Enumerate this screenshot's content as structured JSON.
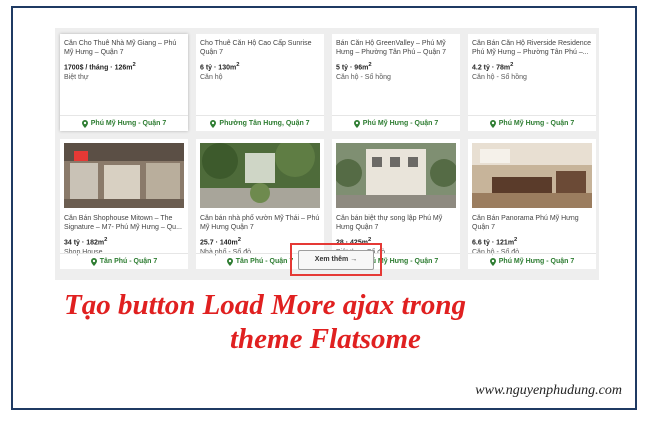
{
  "listings_row1": [
    {
      "title": "Căn Cho Thuê Nhà Mỹ Giang – Phú Mỹ Hưng – Quận 7",
      "price": "1700$ / tháng",
      "area": "126m",
      "type": "Biệt thự",
      "location": "Phú Mỹ Hưng - Quận 7"
    },
    {
      "title": "Cho Thuê Căn Hộ Cao Cấp Sunrise Quận 7",
      "price": "6 tỷ",
      "area": "130m",
      "type": "Căn hộ",
      "location": "Phường Tân Hưng, Quận 7"
    },
    {
      "title": "Bán Căn Hộ GreenValley – Phú Mỹ Hưng – Phường Tân Phú – Quận 7",
      "price": "5 tỷ",
      "area": "96m",
      "type": "Căn hộ - Sổ hồng",
      "location": "Phú Mỹ Hưng - Quận 7"
    },
    {
      "title": "Căn Bán Căn Hộ Riverside Residence Phú Mỹ Hưng – Phường Tân Phú –...",
      "price": "4.2 tỷ",
      "area": "78m",
      "type": "Căn hộ - Sổ hồng",
      "location": "Phú Mỹ Hưng - Quận 7"
    }
  ],
  "listings_row2": [
    {
      "title": "Căn Bán Shophouse Mitown – The Signature – M7- Phú Mỹ Hưng – Qu...",
      "price": "34 tỷ",
      "area": "182m",
      "type": "Shop House",
      "location": "Tân Phú - Quận 7"
    },
    {
      "title": "Căn bán nhà phố vườn Mỹ Thái – Phú Mỹ Hưng Quận 7",
      "price": "25.7",
      "area": "140m",
      "type": "Nhà phố - Sổ đỏ",
      "location": "Tân Phú - Quận 7"
    },
    {
      "title": "Căn bán biệt thự song lập Phú Mỹ Hưng Quận 7",
      "price": "28",
      "area": "425m",
      "type": "Biệt thự - Sổ đỏ",
      "location": "Phú Mỹ Hưng - Quận 7"
    },
    {
      "title": "Căn Bán Panorama Phú Mỹ Hưng Quận 7",
      "price": "6.6 tỷ",
      "area": "121m",
      "type": "Căn hộ - Sổ đỏ",
      "location": "Phú Mỹ Hưng - Quận 7"
    }
  ],
  "area_exp": "2",
  "load_more": {
    "label": "Xem thêm →"
  },
  "headline": {
    "line1": "Tạo button Load More ajax trong",
    "line2": "theme Flatsome"
  },
  "website": "www.nguyenphudung.com",
  "colors": {
    "accent_red": "#e53935",
    "headline_red": "#e02020",
    "location_green": "#2e7d32",
    "frame_navy": "#1f3a63"
  }
}
